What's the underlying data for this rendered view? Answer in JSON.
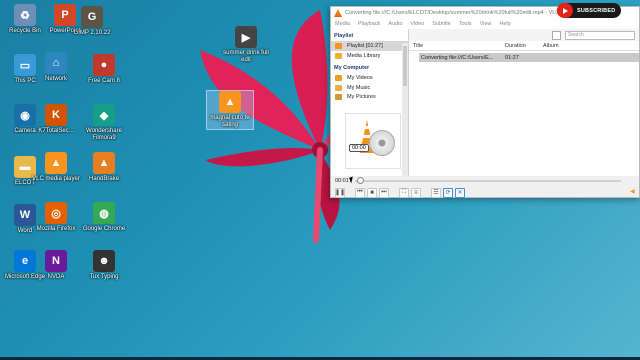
{
  "desktop": {
    "icons": [
      {
        "label": "Recycle Bin",
        "icon": "recycle-bin-icon",
        "color": "#6d8fb5"
      },
      {
        "label": "PowerPoint",
        "icon": "powerpoint-icon",
        "color": "#d24726"
      },
      {
        "label": "GIMP 2.10.22",
        "icon": "gimp-icon",
        "color": "#5c5543"
      },
      {
        "label": "This PC",
        "icon": "computer-icon",
        "color": "#3a9ad9"
      },
      {
        "label": "Network",
        "icon": "network-icon",
        "color": "#2e86c1"
      },
      {
        "label": "Free Cam 8",
        "icon": "free-cam-icon",
        "color": "#c0392b"
      },
      {
        "label": "Camera",
        "icon": "camera-icon",
        "color": "#1b6fa8"
      },
      {
        "label": "K7TotalSec...",
        "icon": "k7-icon",
        "color": "#d35400"
      },
      {
        "label": "Wondershare Filmora9",
        "icon": "filmora-icon",
        "color": "#14a085"
      },
      {
        "label": "ELCOT",
        "icon": "folder-icon",
        "color": "#e8b84a"
      },
      {
        "label": "VLC media player",
        "icon": "vlc-icon",
        "color": "#f7941d"
      },
      {
        "label": "HandBrake",
        "icon": "handbrake-icon",
        "color": "#e67e22"
      },
      {
        "label": "Word",
        "icon": "word-icon",
        "color": "#2b5797"
      },
      {
        "label": "Mozilla Firefox",
        "icon": "firefox-icon",
        "color": "#e66000"
      },
      {
        "label": "Google Chrome",
        "icon": "chrome-icon",
        "color": "#34a853"
      },
      {
        "label": "Microsoft Edge",
        "icon": "edge-icon",
        "color": "#0078d7"
      },
      {
        "label": "NVDA",
        "icon": "nvda-icon",
        "color": "#6a1b9a"
      },
      {
        "label": "Tux Typing",
        "icon": "tux-icon",
        "color": "#333333"
      },
      {
        "label": "summer drink full edit",
        "icon": "video-file-icon",
        "color": "#444444"
      },
      {
        "label": "magnal cuto te sating",
        "icon": "vlc-file-icon",
        "color": "#f7941d"
      }
    ]
  },
  "vlc": {
    "title": "Converting file:///C:/Users/ELCOT/Desktop/summer%20drink%20full%20edit.mp4 - VLC media player",
    "menu": [
      "Media",
      "Playback",
      "Audio",
      "Video",
      "Subtitle",
      "Tools",
      "View",
      "Help"
    ],
    "sidebar": {
      "playlist_header": "Playlist",
      "playlist_items": [
        {
          "label": "Playlist [01:27]",
          "icon": "playlist-icon"
        },
        {
          "label": "Media Library",
          "icon": "media-library-icon"
        }
      ],
      "computer_header": "My Computer",
      "computer_items": [
        {
          "label": "My Videos",
          "icon": "videos-icon"
        },
        {
          "label": "My Music",
          "icon": "music-icon"
        },
        {
          "label": "My Pictures",
          "icon": "pictures-icon"
        }
      ]
    },
    "search_placeholder": "Search",
    "columns": [
      "Title",
      "Duration",
      "Album"
    ],
    "rows": [
      {
        "title": "Converting file:///C:/Users/E...",
        "duration": "01:27",
        "album": ""
      }
    ],
    "art_time": "00:00",
    "elapsed": "00:01",
    "playback_fraction": 0.01
  },
  "badge": {
    "text": "SUBSCRIBED"
  },
  "colors": {
    "accent": "#f7941d",
    "selection": "#d6d6d6",
    "youtube_red": "#e62117"
  }
}
